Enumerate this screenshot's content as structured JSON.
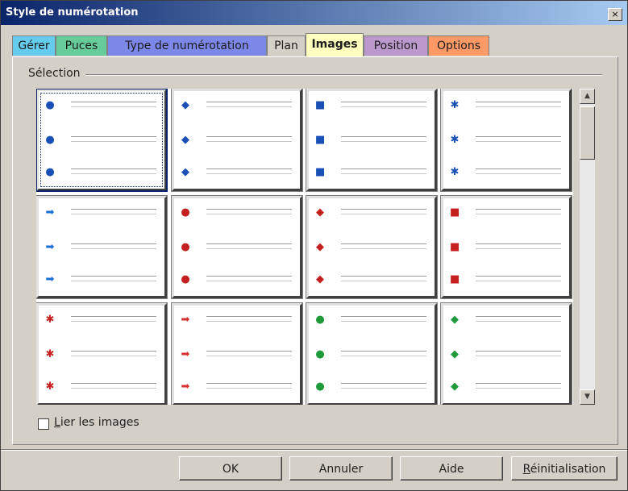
{
  "window": {
    "title": "Style de numérotation",
    "close_label": "×"
  },
  "tabs": [
    {
      "label": "Gérer",
      "color": "#66ccee",
      "active": false
    },
    {
      "label": "Puces",
      "color": "#66cc99",
      "active": false
    },
    {
      "label": "Type de numérotation",
      "color": "#7b88e8",
      "active": false
    },
    {
      "label": "Plan",
      "color": "#d4d0c8",
      "active": false
    },
    {
      "label": "Images",
      "color": "#ffffc0",
      "active": true
    },
    {
      "label": "Position",
      "color": "#bb99cc",
      "active": false
    },
    {
      "label": "Options",
      "color": "#ff9966",
      "active": false
    }
  ],
  "selection": {
    "label": "Sélection",
    "cells": [
      {
        "icon": "blue-sphere-bullet-icon",
        "glyph": "●",
        "color": "#1a4fb5"
      },
      {
        "icon": "blue-diamond-bullet-icon",
        "glyph": "◆",
        "color": "#1a4fb5"
      },
      {
        "icon": "blue-square-bullet-icon",
        "glyph": "■",
        "color": "#1a4fb5"
      },
      {
        "icon": "blue-star-bullet-icon",
        "glyph": "✱",
        "color": "#1a4fb5"
      },
      {
        "icon": "blue-arrow-bullet-icon",
        "glyph": "➡",
        "color": "#1a6fd5"
      },
      {
        "icon": "red-sphere-bullet-icon",
        "glyph": "●",
        "color": "#c42020"
      },
      {
        "icon": "red-diamond-bullet-icon",
        "glyph": "◆",
        "color": "#c42020"
      },
      {
        "icon": "red-square-bullet-icon",
        "glyph": "■",
        "color": "#c42020"
      },
      {
        "icon": "red-star-bullet-icon",
        "glyph": "✱",
        "color": "#c42020"
      },
      {
        "icon": "red-arrow-bullet-icon",
        "glyph": "➡",
        "color": "#d43030"
      },
      {
        "icon": "green-sphere-bullet-icon",
        "glyph": "●",
        "color": "#1f9a3a"
      },
      {
        "icon": "green-diamond-bullet-icon",
        "glyph": "◆",
        "color": "#1f9a3a"
      }
    ]
  },
  "link_images": {
    "label": "Lier les images",
    "checked": false
  },
  "buttons": {
    "ok": "OK",
    "cancel": "Annuler",
    "help": "Aide",
    "reset": "Réinitialisation"
  },
  "scrollbar": {
    "up_glyph": "▲",
    "down_glyph": "▼"
  }
}
